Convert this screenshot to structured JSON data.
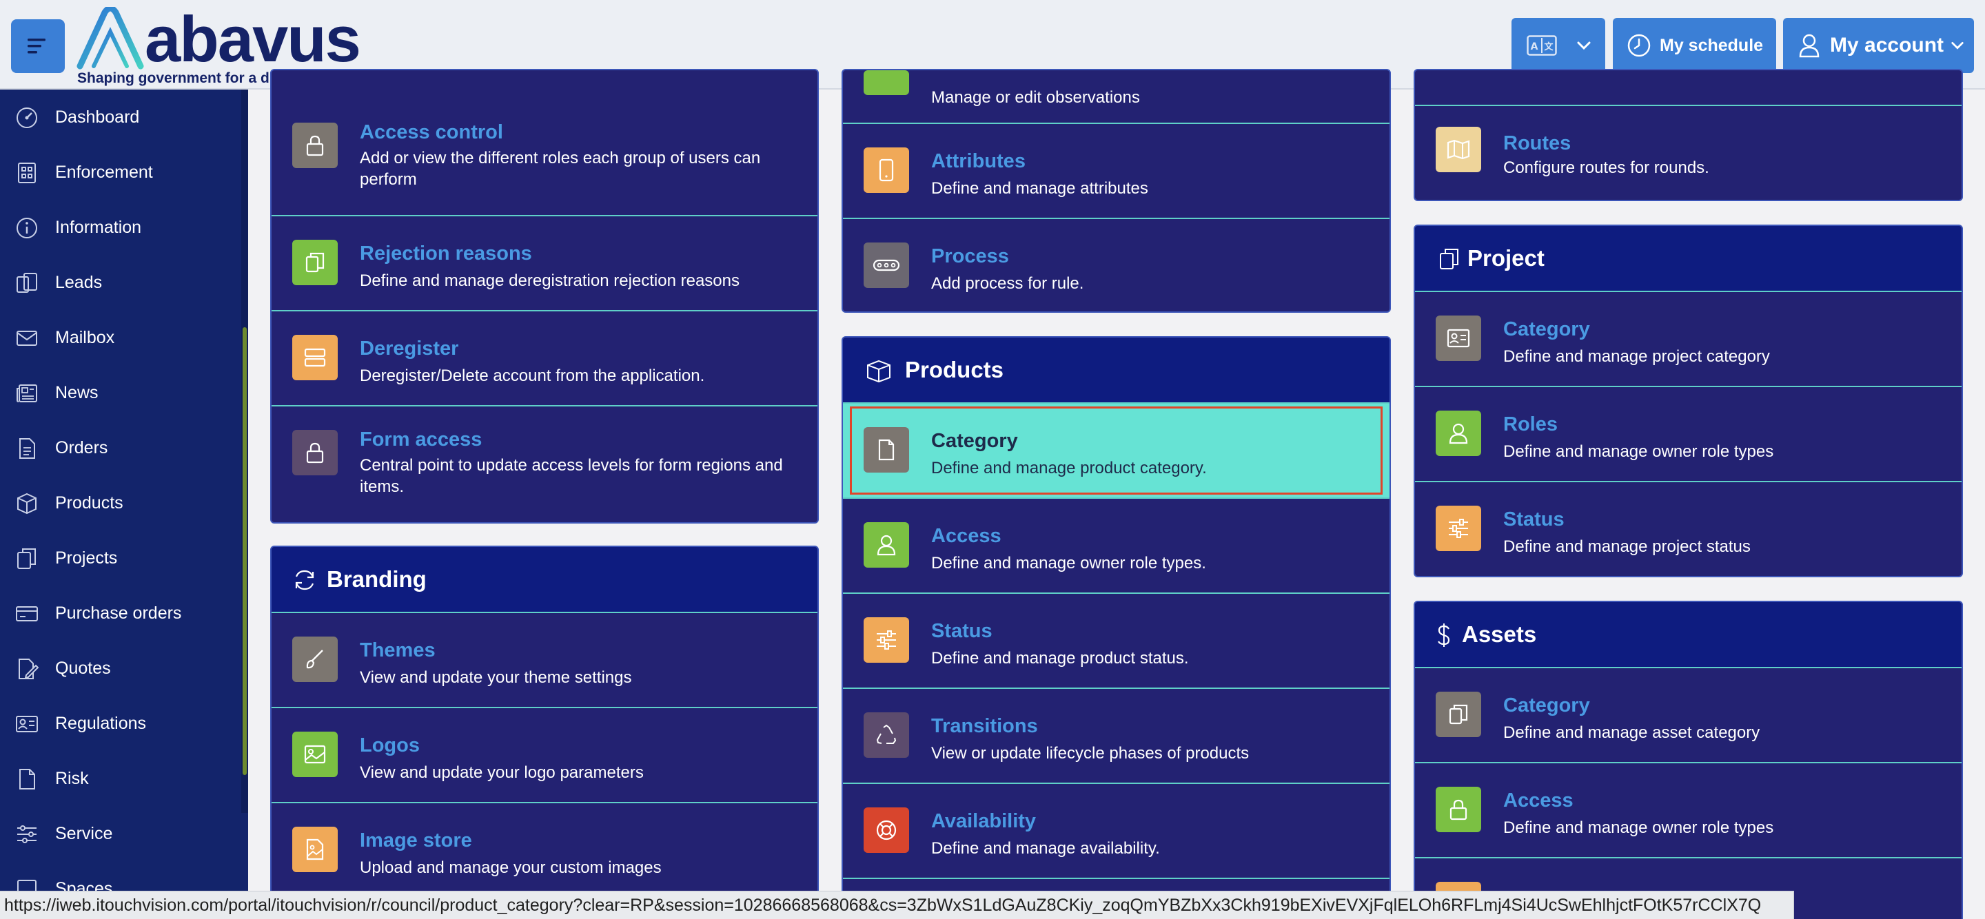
{
  "header": {
    "logo_text": "abavus",
    "tagline": "Shaping government for a digital future",
    "schedule_label": "My schedule",
    "account_label": "My account",
    "accent": "#3b7fd6"
  },
  "sidebar": {
    "items": [
      {
        "label": "Dashboard",
        "icon": "dashboard-icon"
      },
      {
        "label": "Enforcement",
        "icon": "enforcement-icon"
      },
      {
        "label": "Information",
        "icon": "information-icon"
      },
      {
        "label": "Leads",
        "icon": "leads-icon"
      },
      {
        "label": "Mailbox",
        "icon": "mailbox-icon"
      },
      {
        "label": "News",
        "icon": "news-icon"
      },
      {
        "label": "Orders",
        "icon": "orders-icon"
      },
      {
        "label": "Products",
        "icon": "products-icon"
      },
      {
        "label": "Projects",
        "icon": "projects-icon"
      },
      {
        "label": "Purchase orders",
        "icon": "purchase-orders-icon"
      },
      {
        "label": "Quotes",
        "icon": "quotes-icon"
      },
      {
        "label": "Regulations",
        "icon": "regulations-icon"
      },
      {
        "label": "Risk",
        "icon": "risk-icon"
      },
      {
        "label": "Service",
        "icon": "service-icon"
      },
      {
        "label": "Spaces",
        "icon": "spaces-icon"
      }
    ]
  },
  "col1": {
    "partial_rows": [
      {
        "title": "Access control",
        "desc": "Add or view the different roles each group of users can perform"
      },
      {
        "title": "Rejection reasons",
        "desc": "Define and manage deregistration rejection reasons"
      },
      {
        "title": "Deregister",
        "desc": "Deregister/Delete account from the application."
      },
      {
        "title": "Form access",
        "desc": "Central point to update access levels for form regions and items."
      }
    ],
    "branding": {
      "title": "Branding",
      "rows": [
        {
          "title": "Themes",
          "desc": "View and update your theme settings"
        },
        {
          "title": "Logos",
          "desc": "View and update your logo parameters"
        },
        {
          "title": "Image store",
          "desc": "Upload and manage your custom images"
        }
      ]
    }
  },
  "col2": {
    "partial_top_desc": "Manage or edit observations",
    "partial_rows": [
      {
        "title": "Attributes",
        "desc": "Define and manage attributes"
      },
      {
        "title": "Process",
        "desc": "Add process for rule."
      }
    ],
    "products": {
      "title": "Products",
      "rows": [
        {
          "title": "Category",
          "desc": "Define and manage product category."
        },
        {
          "title": "Access",
          "desc": "Define and manage owner role types."
        },
        {
          "title": "Status",
          "desc": "Define and manage product status."
        },
        {
          "title": "Transitions",
          "desc": "View or update lifecycle phases of products"
        },
        {
          "title": "Availability",
          "desc": "Define and manage availability."
        }
      ]
    }
  },
  "col3": {
    "partial_rows": [
      {
        "title": "Routes",
        "desc": "Configure routes for rounds."
      }
    ],
    "project": {
      "title": "Project",
      "rows": [
        {
          "title": "Category",
          "desc": "Define and manage project category"
        },
        {
          "title": "Roles",
          "desc": "Define and manage owner role types"
        },
        {
          "title": "Status",
          "desc": "Define and manage project status"
        }
      ]
    },
    "assets": {
      "title": "Assets",
      "rows": [
        {
          "title": "Category",
          "desc": "Define and manage asset category"
        },
        {
          "title": "Access",
          "desc": "Define and manage owner role types"
        }
      ]
    }
  },
  "statusbar": {
    "url": "https://iweb.itouchvision.com/portal/itouchvision/r/council/product_category?clear=RP&session=10286668568068&cs=3ZbWxS1LdGAuZ8CKiy_zoqQmYBZbXx3Ckh919bEXivEVXjFqlELOh6RFLmj4Si4UcSwEhlhjctFOtK57rCClX7Q"
  }
}
